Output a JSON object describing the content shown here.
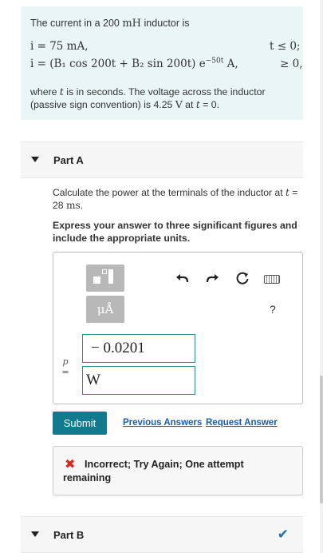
{
  "problem": {
    "intro_prefix": "The current in a 200",
    "intro_unit": "mH",
    "intro_suffix": "inductor is",
    "eq1_lhs": "i = 75 mA,",
    "eq1_cond": "t ≤ 0;",
    "eq2_lhs": "i = (B₁ cos 200t + B₂ sin 200t) e",
    "eq2_exp": "−50t",
    "eq2_unit": " A,",
    "eq2_cond": "≥ 0,",
    "where_a": "where",
    "where_t": "t",
    "where_b": "is in seconds. The voltage across the inductor (passive sign convention) is 4.25",
    "where_v": "V",
    "where_c": "at",
    "where_t0": "t",
    "where_d": "= 0."
  },
  "part_a": {
    "title": "Part A",
    "question_a": "Calculate the power at the terminals of the inductor at",
    "question_t": "t",
    "question_b": "= 28",
    "question_ms": "ms",
    "question_c": ".",
    "instructions": "Express your answer to three significant figures and include the appropriate units.",
    "units_button": "μÅ",
    "help": "?",
    "var_top": "p",
    "var_bottom": "=",
    "value": "− 0.0201",
    "unit": "W",
    "submit": "Submit",
    "previous_answers": "Previous Answers",
    "request_answer": "Request Answer",
    "feedback": "Incorrect; Try Again; One attempt remaining"
  },
  "part_b": {
    "title": "Part B"
  },
  "icons": {
    "undo": "undo-icon",
    "redo": "redo-icon",
    "reset": "reset-icon",
    "keyboard": "keyboard-icon",
    "incorrect": "x-icon",
    "complete": "checkmark-icon"
  },
  "colors": {
    "problem_bg": "#e9f6f5",
    "submit": "#127a8f",
    "link": "#1a5fa8",
    "error": "#d9281e",
    "field_border": "#2c8a8e"
  }
}
